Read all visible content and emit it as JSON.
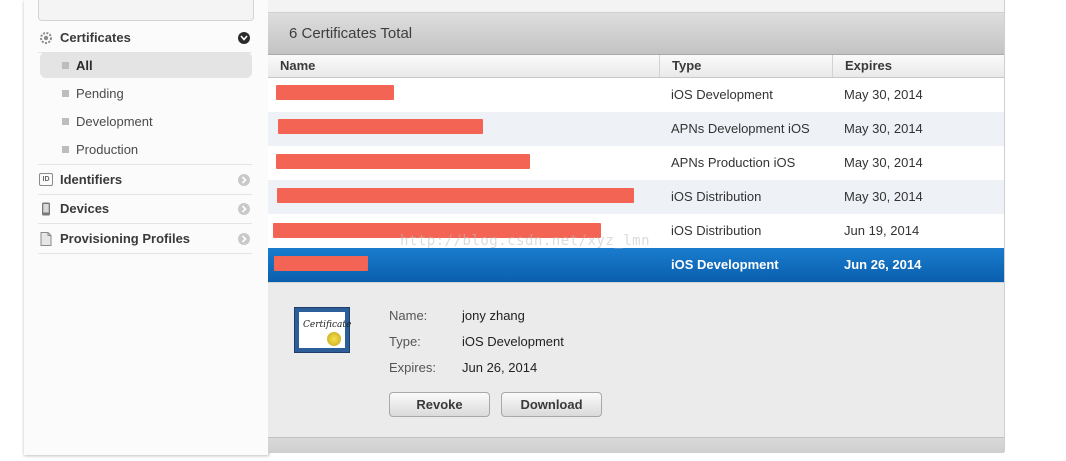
{
  "sidebar": {
    "certificates": {
      "label": "Certificates",
      "icon": "gear-icon"
    },
    "sub_items": [
      {
        "label": "All",
        "selected": true
      },
      {
        "label": "Pending",
        "selected": false
      },
      {
        "label": "Development",
        "selected": false
      },
      {
        "label": "Production",
        "selected": false
      }
    ],
    "identifiers": {
      "label": "Identifiers",
      "icon": "id-icon",
      "icon_text": "ID"
    },
    "devices": {
      "label": "Devices",
      "icon": "device-icon"
    },
    "profiles": {
      "label": "Provisioning Profiles",
      "icon": "document-icon"
    }
  },
  "list": {
    "title": "6 Certificates Total",
    "columns": [
      "Name",
      "Type",
      "Expires"
    ],
    "rows": [
      {
        "type": "iOS Development",
        "expires": "May 30, 2014",
        "name_redacted": true
      },
      {
        "type": "APNs Development iOS",
        "expires": "May 30, 2014",
        "name_redacted": true
      },
      {
        "type": "APNs Production iOS",
        "expires": "May 30, 2014",
        "name_redacted": true
      },
      {
        "type": "iOS Distribution",
        "expires": "May 30, 2014",
        "name_redacted": true
      },
      {
        "type": "iOS Distribution",
        "expires": "Jun 19, 2014",
        "name_redacted": true
      },
      {
        "type": "iOS Development",
        "expires": "Jun 26, 2014",
        "name_redacted": true,
        "selected": true
      }
    ]
  },
  "detail": {
    "name_label": "Name:",
    "name_value": "jony zhang",
    "type_label": "Type:",
    "type_value": "iOS Development",
    "expires_label": "Expires:",
    "expires_value": "Jun 26, 2014",
    "icon_text": "Certificate",
    "revoke_label": "Revoke",
    "download_label": "Download"
  },
  "watermark": "http://blog.csdn.net/xyz_lmn",
  "colors": {
    "selected_row": "#0a5fae",
    "redaction": "#f46454"
  }
}
